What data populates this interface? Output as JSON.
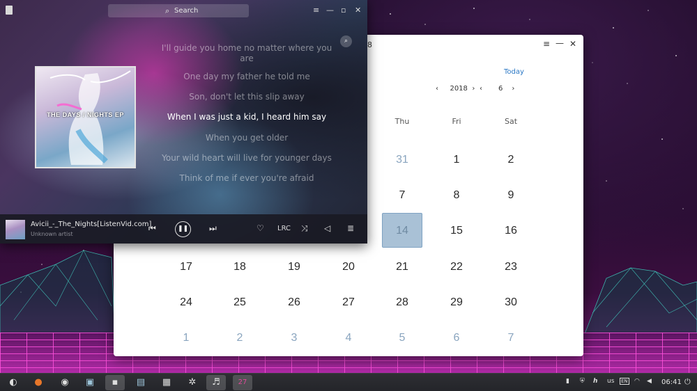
{
  "player": {
    "search_placeholder": "Search",
    "icons": {
      "app": "music-app-icon",
      "search": "search-icon",
      "menu": "menu-icon",
      "minimize": "minimize-icon",
      "maximize": "maximize-icon",
      "close": "close-icon"
    },
    "lyrics": [
      "I'll guide you home no matter where you",
      "are",
      "One day my father he told me",
      "Son, don't let this slip away",
      "When I was just a kid, I heard him say",
      "When you get older",
      "Your wild heart will live for younger days",
      "Think of me if ever you're afraid"
    ],
    "active_lyric_index": 4,
    "cover_text": "THE DAYS / NIGHTS EP",
    "now_playing": {
      "title": "Avicii_-_The_Nights[ListenVid.com]",
      "artist": "Unknown artist"
    },
    "controls": {
      "prev": "previous-icon",
      "play_pause": "pause-icon",
      "next": "next-icon",
      "favorite": "heart-icon",
      "lrc_label": "LRC",
      "shuffle": "shuffle-icon",
      "volume": "volume-icon",
      "playlist": "playlist-icon"
    }
  },
  "calendar": {
    "title_fragment": "8",
    "today_label": "Today",
    "year": "2018",
    "month": "6",
    "weekday_headers": [
      "Thu",
      "Fri",
      "Sat"
    ],
    "rows": [
      [
        "31",
        "1",
        "2"
      ],
      [
        "7",
        "8",
        "9"
      ],
      [
        "14",
        "15",
        "16"
      ],
      [
        "17",
        "18",
        "19",
        "20",
        "21",
        "22",
        "23"
      ],
      [
        "24",
        "25",
        "26",
        "27",
        "28",
        "29",
        "30"
      ],
      [
        "1",
        "2",
        "3",
        "4",
        "5",
        "6",
        "7"
      ]
    ],
    "selected_day": "14"
  },
  "taskbar": {
    "apps": [
      "launcher-icon",
      "firefox-icon",
      "disk-icon",
      "file-manager-icon",
      "terminal-icon",
      "image-viewer-icon",
      "document-icon",
      "settings-gear-icon",
      "music-player-icon",
      "calendar-icon"
    ],
    "calendar_app_label": "27",
    "tray": {
      "keyboard_layout": "us",
      "input_method": "EN",
      "time": "06:41"
    }
  }
}
